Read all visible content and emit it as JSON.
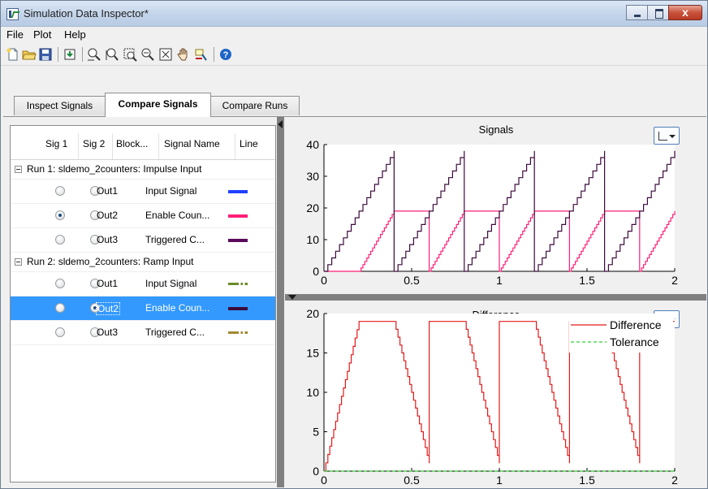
{
  "window": {
    "title": "Simulation Data Inspector*",
    "close_glyph": "x"
  },
  "menu": [
    "File",
    "Plot",
    "Help"
  ],
  "toolbar": {
    "icons": [
      "new-icon",
      "open-icon",
      "save-icon",
      "import-icon",
      "zoom-in-x-icon",
      "zoom-in-y-icon",
      "zoom-in-icon",
      "zoom-out-icon",
      "fit-to-view-icon",
      "pan-icon",
      "data-cursor-icon",
      "help-icon"
    ],
    "help_glyph": "?"
  },
  "tabs": [
    {
      "label": "Inspect Signals",
      "active": false
    },
    {
      "label": "Compare Signals",
      "active": true
    },
    {
      "label": "Compare Runs",
      "active": false
    }
  ],
  "table": {
    "headers": [
      "Sig 1",
      "Sig 2",
      "Block...",
      "Signal Name",
      "Line"
    ],
    "runs": [
      {
        "label": "Run 1: sldemo_2counters: Impulse Input",
        "signals": [
          {
            "block": "Out1",
            "name": "Input Signal",
            "sig1": false,
            "sig2": false,
            "line_color": "#1f3fff",
            "line_style": "solid",
            "selected": false
          },
          {
            "block": "Out2",
            "name": "Enable Coun...",
            "sig1": true,
            "sig2": false,
            "line_color": "#ff1f77",
            "line_style": "solid",
            "selected": false
          },
          {
            "block": "Out3",
            "name": "Triggered C...",
            "sig1": false,
            "sig2": false,
            "line_color": "#5a0a5a",
            "line_style": "solid",
            "selected": false
          }
        ]
      },
      {
        "label": "Run 2: sldemo_2counters: Ramp Input",
        "signals": [
          {
            "block": "Out1",
            "name": "Input Signal",
            "sig1": false,
            "sig2": false,
            "line_color": "#6b8a2a",
            "line_style": "dashdot",
            "selected": false
          },
          {
            "block": "Out2",
            "name": "Enable Coun...",
            "sig1": false,
            "sig2": true,
            "line_color": "#3b0a3b",
            "line_style": "solid",
            "selected": true
          },
          {
            "block": "Out3",
            "name": "Triggered C...",
            "sig1": false,
            "sig2": false,
            "line_color": "#a08a30",
            "line_style": "dashdot",
            "selected": false
          }
        ]
      }
    ]
  },
  "chart_data": [
    {
      "type": "line",
      "title": "Signals",
      "xlim": [
        0,
        2
      ],
      "ylim": [
        0,
        40
      ],
      "xticks": [
        "0",
        "0.5",
        "1",
        "1.5",
        "2"
      ],
      "yticks": [
        "0",
        "10",
        "20",
        "30",
        "40"
      ],
      "series": [
        {
          "color": "#ff1f77",
          "x": [
            0,
            0.2,
            0.2,
            0.4,
            0.4,
            0.6,
            0.6,
            0.8,
            0.8,
            1.0,
            1.0,
            1.2,
            1.2,
            1.4,
            1.4,
            1.6,
            1.6,
            1.8,
            1.8,
            2.0
          ],
          "y": [
            0,
            0,
            0,
            19,
            19,
            19,
            0,
            19,
            19,
            19,
            0,
            19,
            19,
            19,
            0,
            19,
            19,
            19,
            0,
            19
          ]
        },
        {
          "color": "#3b0a3b",
          "x": [
            0,
            0.4,
            0.4,
            0.8,
            0.8,
            1.2,
            1.2,
            1.6,
            1.6,
            2.0
          ],
          "y": [
            0,
            38,
            0,
            38,
            0,
            38,
            0,
            38,
            0,
            38
          ]
        }
      ]
    },
    {
      "type": "line",
      "title": "Difference",
      "xlim": [
        0,
        2
      ],
      "ylim": [
        0,
        20
      ],
      "xticks": [
        "0",
        "0.5",
        "1",
        "1.5",
        "2"
      ],
      "yticks": [
        "0",
        "5",
        "10",
        "15",
        "20"
      ],
      "legend": {
        "placement": "top-right",
        "entries": [
          "Difference",
          "Tolerance"
        ]
      },
      "series": [
        {
          "name": "Difference",
          "color": "#e31a1a",
          "x": [
            0,
            0.2,
            0.4,
            0.6,
            0.6,
            0.8,
            1.0,
            1.0,
            1.2,
            1.4,
            1.4,
            1.6,
            1.8,
            1.8,
            2.0
          ],
          "y": [
            0,
            19,
            19,
            1,
            19,
            19,
            1,
            19,
            19,
            1,
            19,
            19,
            1,
            19,
            19
          ]
        },
        {
          "name": "Tolerance",
          "color": "#2fcf2f",
          "style": "dashed",
          "x": [
            0,
            2.0
          ],
          "y": [
            0,
            0
          ]
        }
      ]
    }
  ]
}
